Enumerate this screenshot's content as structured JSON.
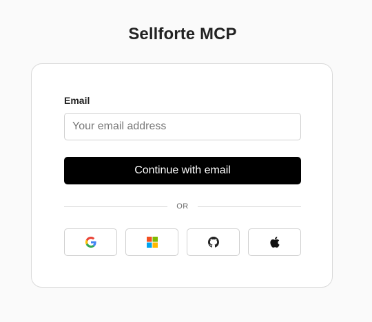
{
  "app": {
    "title": "Sellforte MCP"
  },
  "form": {
    "email_label": "Email",
    "email_placeholder": "Your email address",
    "email_value": "",
    "continue_label": "Continue with email",
    "divider_text": "OR"
  },
  "providers": [
    {
      "name": "Google",
      "icon": "google-icon"
    },
    {
      "name": "Microsoft",
      "icon": "microsoft-icon"
    },
    {
      "name": "GitHub",
      "icon": "github-icon"
    },
    {
      "name": "Apple",
      "icon": "apple-icon"
    }
  ],
  "colors": {
    "primary_button": "#000000",
    "background": "#fafafa",
    "card": "#ffffff",
    "border": "#d9d9d9"
  }
}
